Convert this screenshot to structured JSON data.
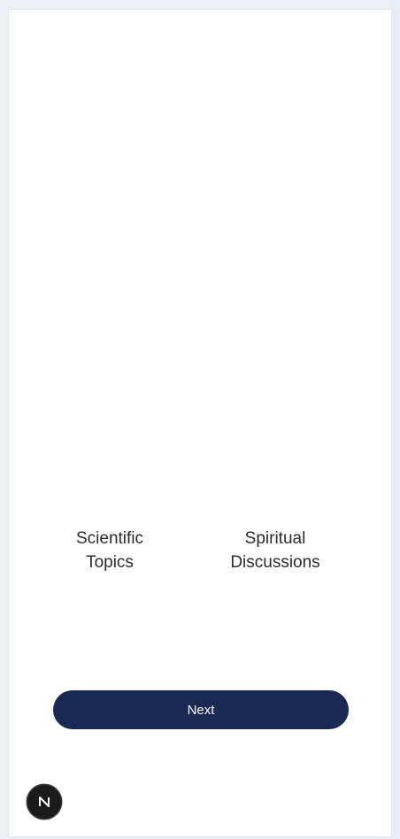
{
  "topics": [
    {
      "label": "Scientific\nTopics"
    },
    {
      "label": "Spiritual\nDiscussions"
    }
  ],
  "actions": {
    "next_label": "Next"
  },
  "colors": {
    "primary_button": "#1b2a55",
    "page_background": "#ffffff",
    "fab_background": "#1a1a1a"
  },
  "icons": {
    "fab_icon": "next-logo-icon"
  }
}
